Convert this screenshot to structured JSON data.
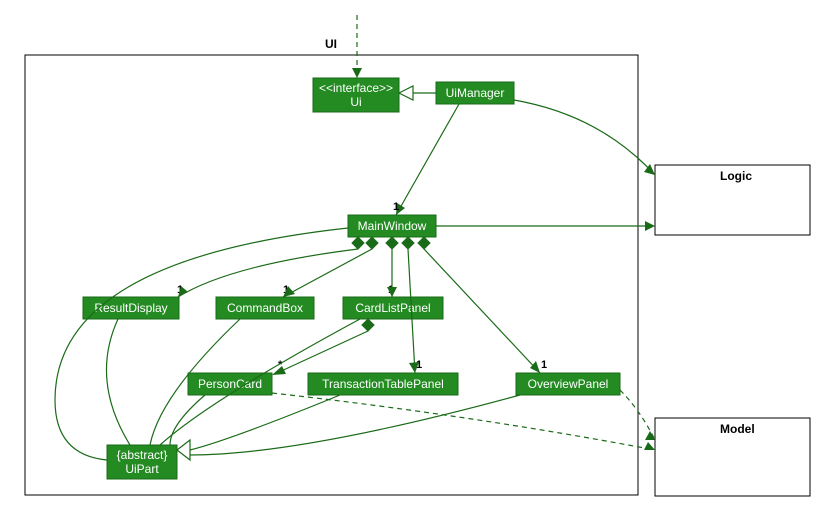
{
  "diagram": {
    "type": "uml_class",
    "packages": {
      "ui": "UI",
      "logic": "Logic",
      "model": "Model"
    },
    "classes": {
      "ui_interface": {
        "stereotype": "<<interface>>",
        "name": "Ui"
      },
      "ui_manager": "UiManager",
      "main_window": "MainWindow",
      "result_display": "ResultDisplay",
      "command_box": "CommandBox",
      "card_list_panel": "CardListPanel",
      "person_card": "PersonCard",
      "transaction_table_panel": "TransactionTablePanel",
      "overview_panel": "OverviewPanel",
      "ui_part": {
        "stereotype": "{abstract}",
        "name": "UiPart"
      }
    },
    "multiplicities": {
      "main_window_m": "1",
      "result_display_m": "1",
      "command_box_m": "1",
      "card_list_panel_m": "1",
      "person_card_m": "*",
      "transaction_table_panel_m": "1",
      "overview_panel_m": "1"
    },
    "relationships": [
      {
        "from": "outside",
        "to": "ui_interface",
        "type": "dependency"
      },
      {
        "from": "ui_manager",
        "to": "ui_interface",
        "type": "realization"
      },
      {
        "from": "ui_manager",
        "to": "main_window",
        "type": "association",
        "mult": "1"
      },
      {
        "from": "ui_manager",
        "to": "logic",
        "type": "association"
      },
      {
        "from": "main_window",
        "to": "result_display",
        "type": "composition",
        "mult": "1"
      },
      {
        "from": "main_window",
        "to": "command_box",
        "type": "composition",
        "mult": "1"
      },
      {
        "from": "main_window",
        "to": "card_list_panel",
        "type": "composition",
        "mult": "1"
      },
      {
        "from": "main_window",
        "to": "transaction_table_panel",
        "type": "composition",
        "mult": "1"
      },
      {
        "from": "main_window",
        "to": "overview_panel",
        "type": "composition",
        "mult": "1"
      },
      {
        "from": "main_window",
        "to": "logic",
        "type": "association"
      },
      {
        "from": "card_list_panel",
        "to": "person_card",
        "type": "composition",
        "mult": "*"
      },
      {
        "from": "main_window",
        "to": "ui_part",
        "type": "generalization"
      },
      {
        "from": "result_display",
        "to": "ui_part",
        "type": "generalization"
      },
      {
        "from": "command_box",
        "to": "ui_part",
        "type": "generalization"
      },
      {
        "from": "card_list_panel",
        "to": "ui_part",
        "type": "generalization"
      },
      {
        "from": "person_card",
        "to": "ui_part",
        "type": "generalization"
      },
      {
        "from": "transaction_table_panel",
        "to": "ui_part",
        "type": "generalization"
      },
      {
        "from": "overview_panel",
        "to": "ui_part",
        "type": "generalization"
      },
      {
        "from": "person_card",
        "to": "model",
        "type": "dependency"
      },
      {
        "from": "overview_panel",
        "to": "model",
        "type": "dependency"
      }
    ]
  }
}
